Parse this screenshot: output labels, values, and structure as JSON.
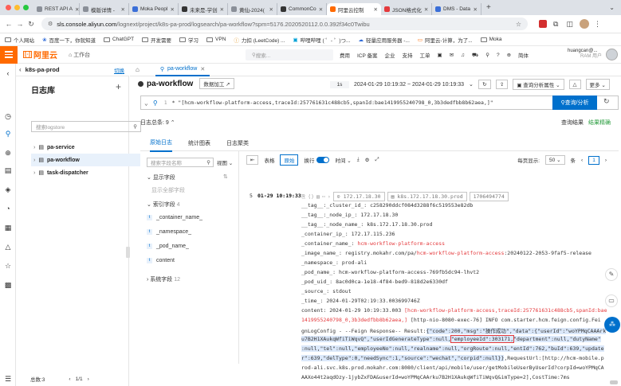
{
  "browser": {
    "tabs": [
      {
        "label": "REST API A",
        "active": false,
        "color": "#8a8f98"
      },
      {
        "label": "模版详情 -",
        "active": false,
        "color": "#8a8f98"
      },
      {
        "label": "Moka Peopl",
        "active": false,
        "color": "#3b6fd8"
      },
      {
        "label": "未来是-学创",
        "active": false,
        "color": "#333333"
      },
      {
        "label": "黄仙-2024(",
        "active": false,
        "color": "#8a8f98"
      },
      {
        "label": "CommonCo",
        "active": false,
        "color": "#333333"
      },
      {
        "label": "阿里云控制",
        "active": true,
        "color": "#ff6a00"
      },
      {
        "label": "JSON格式化",
        "active": false,
        "color": "#e4393c"
      },
      {
        "label": "DMS - Data",
        "active": false,
        "color": "#3b6fd8"
      }
    ],
    "url_domain": "sls.console.aliyun.com",
    "url_path": "/lognext/project/k8s-pa-prod/logsearch/pa-workflow?spm=5176.2020520112.0.0.392f34c0Twibu",
    "bookmarks": [
      "个人网站",
      "百度一下，你就知道",
      "ChatGPT",
      "开发需要",
      "学习",
      "VPN",
      "力扣 (LeetCode) ...",
      "哔哩哔哩 ( ゜- ゜)つ...",
      "轻量应用服务器 -...",
      "阿里云-计算，为了...",
      "Moka"
    ]
  },
  "topnav": {
    "logo": "阿里云",
    "workspace": "工作台",
    "search_placeholder": "搜索...",
    "links": [
      "费用",
      "ICP 备案",
      "企业",
      "支持",
      "工单"
    ],
    "lang": "简体",
    "user_name": "huangcan@...",
    "user_role": "RAM 用户"
  },
  "project": {
    "name": "k8s-pa-prod",
    "switch": "切换"
  },
  "store": {
    "title": "日志库",
    "search_placeholder": "搜索logstore",
    "items": [
      "pa-service",
      "pa-workflow",
      "task-dispatcher"
    ],
    "footer_total": "总数:3",
    "footer_page": "1/1"
  },
  "logtab": {
    "label": "pa-workflow"
  },
  "header": {
    "title": "pa-workflow",
    "badge": "数据加工",
    "range_label": "1s",
    "time_range": "2024-01-29 10:19:32 ~ 2024-01-29 10:19:33",
    "analysis": "查询分析属性",
    "more": "更多"
  },
  "query": {
    "line": "1",
    "text": "* \"[hcm-workflow-platform-access,traceId:257761631c488cb5,spanId:bae1419955240798_0,3b3dedfbb8b62aea,]\"",
    "button": "查询/分析"
  },
  "counts": {
    "total": "日志总条: 9",
    "raw": "查询结果",
    "accuracy": "结果精确"
  },
  "subtabs": [
    "原始日志",
    "统计图表",
    "日志聚类"
  ],
  "fields": {
    "search_placeholder": "搜索字段名称",
    "view": "视图",
    "shown": "显示字段",
    "shown_empty": "显示全部字段",
    "indexed": "索引字段",
    "indexed_count": "4",
    "list": [
      "_container_name_",
      "_namespace_",
      "_pod_name_",
      "content"
    ],
    "system": "系统字段",
    "system_count": "12"
  },
  "logtoolbar": {
    "table": "表格",
    "raw": "原始",
    "wrap": "换行",
    "time": "时间",
    "per_page_label": "每页显示:",
    "per_page": "50",
    "items_label": "条",
    "page": "1"
  },
  "log": {
    "index": "5",
    "time": "01-29 10:19:33",
    "ip_tag": "172.17.18.30",
    "host_tag": "k8s.172.17.18.30.prod",
    "ts_tag": "1706494774",
    "lines": [
      {
        "k": "__tag__:_cluster_id_:",
        "v": "c258290ddcf084d3288f6c519553e82db"
      },
      {
        "k": "__tag__:_node_ip_:",
        "v": "172.17.18.30"
      },
      {
        "k": "__tag__:_node_name_:",
        "v": "k8s.172.17.18.30.prod"
      },
      {
        "k": "_container_ip_:",
        "v": "172.17.115.236"
      },
      {
        "k": "_container_name_:",
        "v": "hcm-workflow-platform-access",
        "hl": true
      },
      {
        "k": "_image_name_:",
        "v": "registry.mokahr.com/pa/",
        "v2": "hcm-workflow-platform-access",
        "v3": ":20240122-2053-9faf5-release"
      },
      {
        "k": "_namespace_:",
        "v": "prod-ali"
      },
      {
        "k": "_pod_name_:",
        "v": "hcm-workflow-platform-access-769fb5dc94-lhvt2"
      },
      {
        "k": "_pod_uid_:",
        "v": "8ac0d0ca-1e18-4f84-bed9-818d2e6330df"
      },
      {
        "k": "_source_:",
        "v": "stdout"
      },
      {
        "k": "_time_:",
        "v": "2024-01-29T02:19:33.003699746Z"
      }
    ],
    "content_prefix": "content: 2024-01-29 10:19:33.003 ",
    "content_hl1": "[hcm-workflow-platform-access,traceId:257761631c488cb5,spanId:bae",
    "content_hl2": "1419955240798_0,3b3dedfbb8b62aea,]",
    "content_mid": " [http-nio-8080-exec-76] INFO  com.starter.hcm.feign.config.Fei",
    "content_l3a": "gnLogConfig - --Feign Response-- Result:",
    "content_l3b": "{\"code\":200,\"msg\":\"操作成功\",\"data\":{\"userId\":\"woYPMqCAAArk",
    "content_l4a": "u7B2H1XAukqWfiTiWqvQ\",\"userIdGenerateType\":null,",
    "content_l4box": "\"employeeId\":303171,",
    "content_l4b": "\"department\":null,\"dutyName\"",
    "content_l5": ":null,\"tel\":null,\"employeeNo\":null,\"realname\":null,\"orgRoute\":null,\"entId\":762,\"buId\":639,\"update",
    "content_l6": "r\":639,\"delType\":0,\"needSync\":1,\"source\":\"wechat\",\"corpid\":null}}",
    "content_l6b": ",RequestUrl:[http://hcm-mobile.p",
    "content_l7": "rod-ali.svc.k8s.prod.mokahr.com:8080/client/api/mobile/user/getMobileUserByUserId?corpId=woYPMqCA",
    "content_l8": "AAXo44t2aqdOzy-1jybZxFDA&userId=woYPMqCAArku7B2H1XAukqWfiTiWqvQ&imType=2],CostTime:7ms"
  },
  "colors": {
    "accent": "#0070cc",
    "brand": "#ff6a00",
    "highlight": "#e4393c",
    "selection": "#dbe8fa"
  }
}
